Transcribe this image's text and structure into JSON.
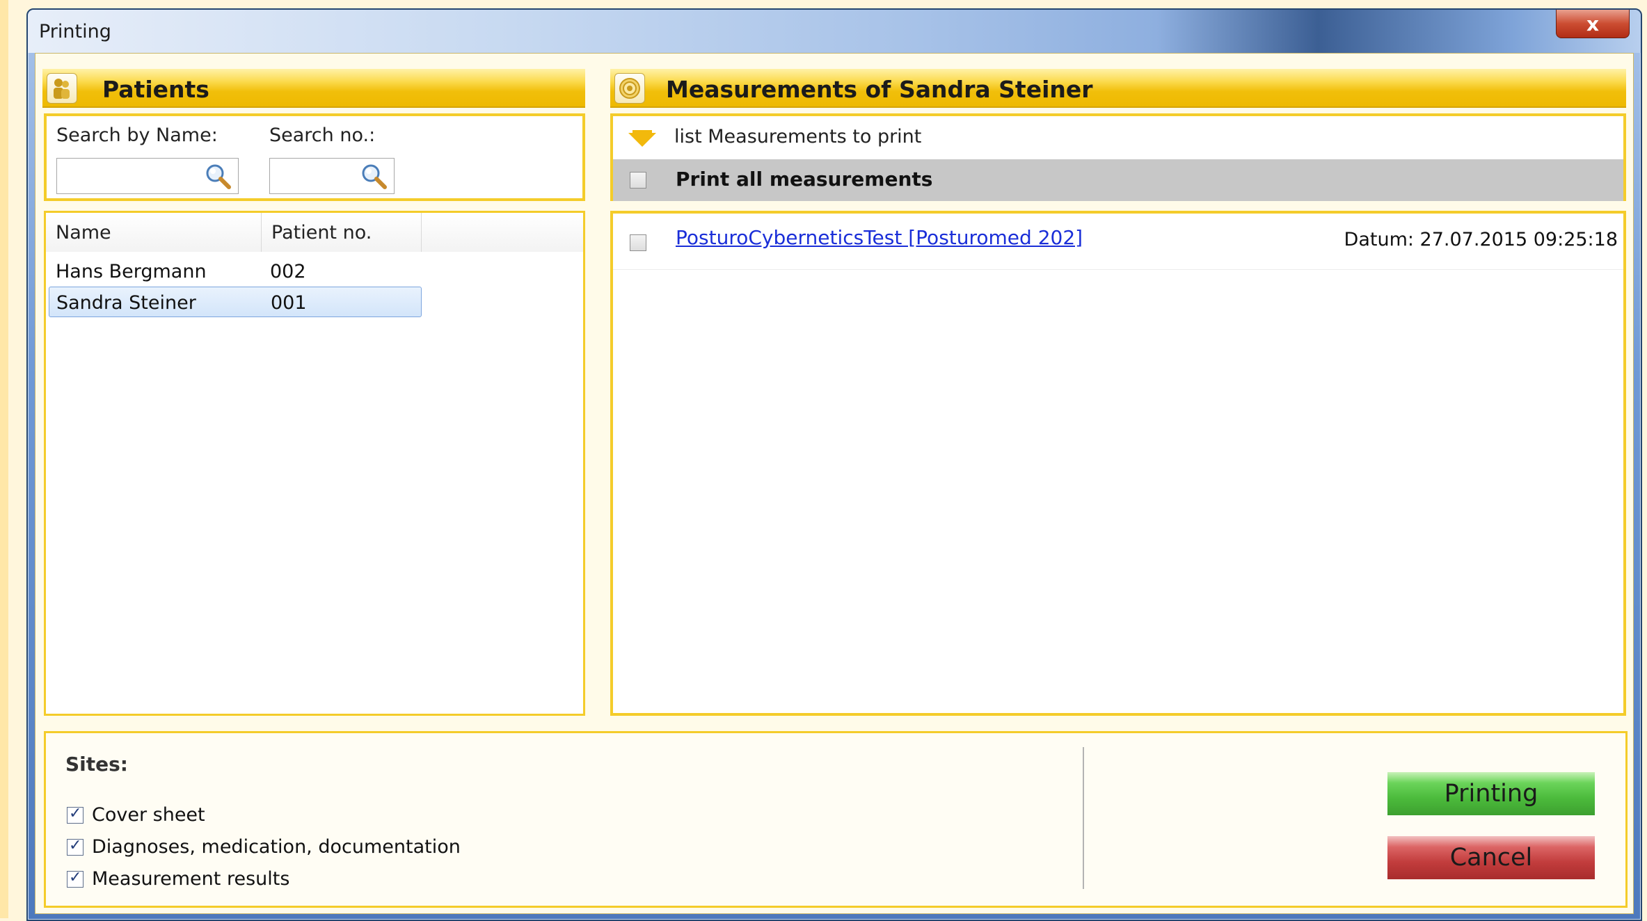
{
  "window": {
    "title": "Printing",
    "close_label": "x"
  },
  "patients_panel": {
    "title": "Patients",
    "search_name_label": "Search by Name:",
    "search_no_label": "Search no.:",
    "search_name_value": "",
    "search_no_value": "",
    "columns": [
      "Name",
      "Patient no."
    ],
    "rows": [
      {
        "name": "Hans Bergmann",
        "no": "002",
        "selected": false
      },
      {
        "name": "Sandra Steiner",
        "no": "001",
        "selected": true
      }
    ]
  },
  "measurements_panel": {
    "title": "Measurements of Sandra Steiner",
    "list_hint": "list Measurements to print",
    "print_all_label": "Print all measurements",
    "print_all_checked": false,
    "items": [
      {
        "label": "PosturoCyberneticsTest [Posturomed 202]",
        "date": "Datum: 27.07.2015 09:25:18",
        "checked": false
      }
    ]
  },
  "sites": {
    "label": "Sites:",
    "options": [
      {
        "label": "Cover sheet",
        "checked": true
      },
      {
        "label": "Diagnoses, medication, documentation",
        "checked": true
      },
      {
        "label": "Measurement results",
        "checked": true
      }
    ]
  },
  "buttons": {
    "print_label": "Printing",
    "cancel_label": "Cancel"
  },
  "colors": {
    "accent": "#f1bf0b",
    "print": "#4cbb3c",
    "cancel": "#c23d3d",
    "link": "#1a2ed8"
  }
}
